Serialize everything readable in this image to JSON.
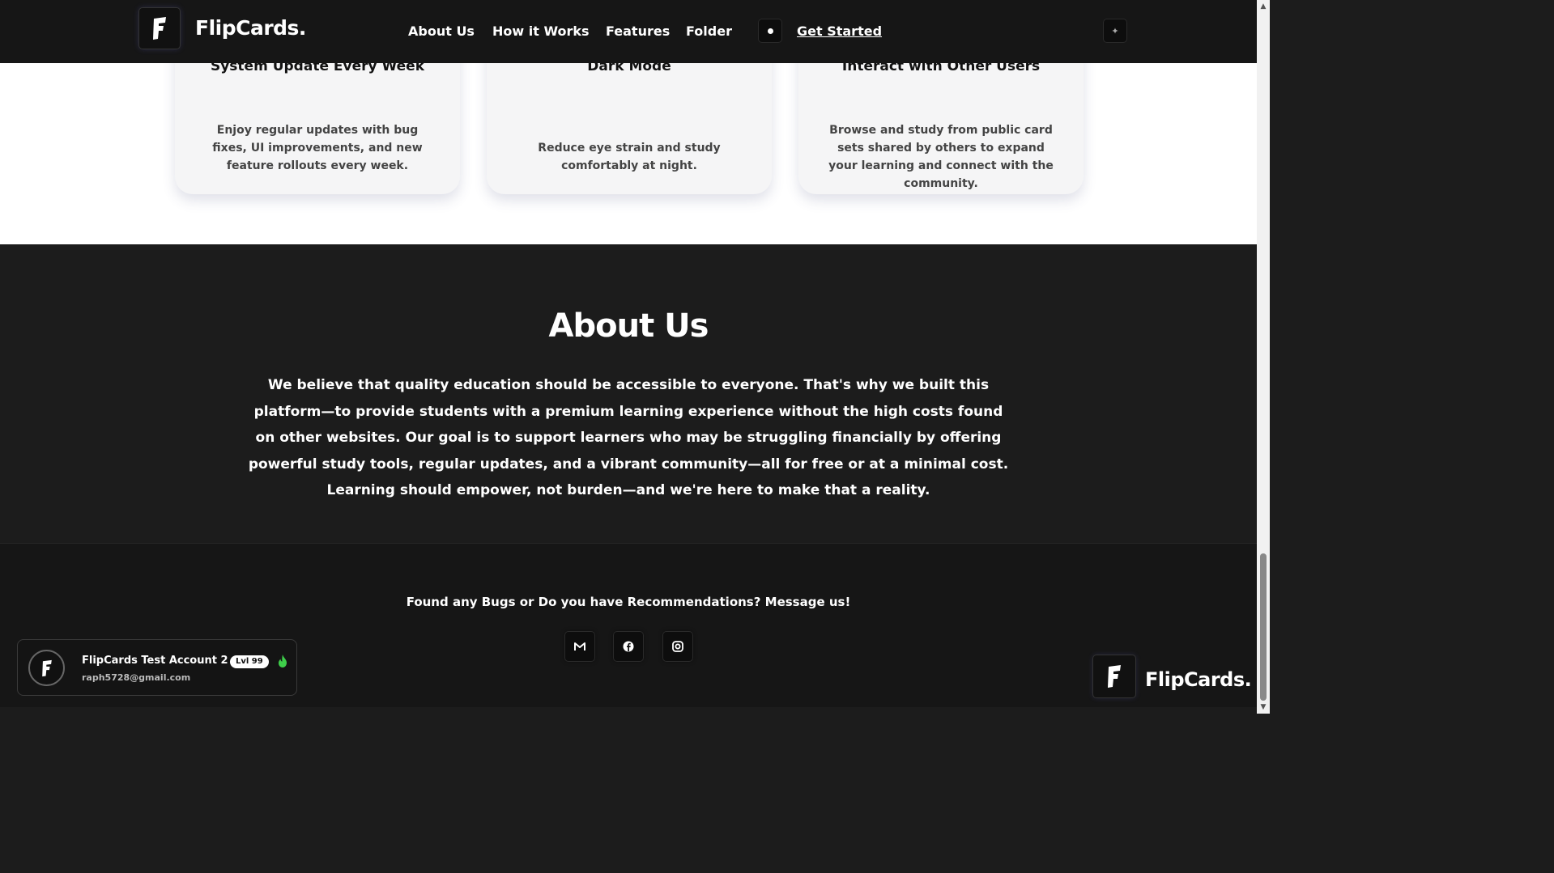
{
  "navbar": {
    "brand": "FlipCards.",
    "links": {
      "about": "About Us",
      "how": "How it Works",
      "features": "Features",
      "folder": "Folder",
      "get_started": "Get Started"
    }
  },
  "feature_cards": [
    {
      "title": "System Update Every Week",
      "text": "Enjoy regular updates with bug fixes, UI improvements, and new feature rollouts every week."
    },
    {
      "title": "Dark Mode",
      "text": "Reduce eye strain and study comfortably at night."
    },
    {
      "title": "Interact with Other Users",
      "text": "Browse and study from public card sets shared by others to expand your learning and connect with the community."
    }
  ],
  "about": {
    "heading": "About Us",
    "body": "We believe that quality education should be accessible to everyone. That's why we built this platform—to provide students with a premium learning experience without the high costs found on other websites. Our goal is to support learners who may be struggling financially by offering powerful study tools, regular updates, and a vibrant community—all for free or at a minimal cost. Learning should empower, not burden—and we're here to make that a reality."
  },
  "footer": {
    "message": "Found any Bugs or Do you have Recommendations? Message us!",
    "brand": "FlipCards.",
    "socials": [
      "gmail-icon",
      "facebook-icon",
      "instagram-icon"
    ]
  },
  "account": {
    "name": "FlipCards Test Account 2",
    "level": "Lvl 99",
    "email": "raph5728@gmail.com"
  },
  "colors": {
    "dark_bg": "#1c1c1c",
    "nav_bg": "#161616",
    "card_bg": "#f5f5f6",
    "flame": "#3ecf4a"
  }
}
